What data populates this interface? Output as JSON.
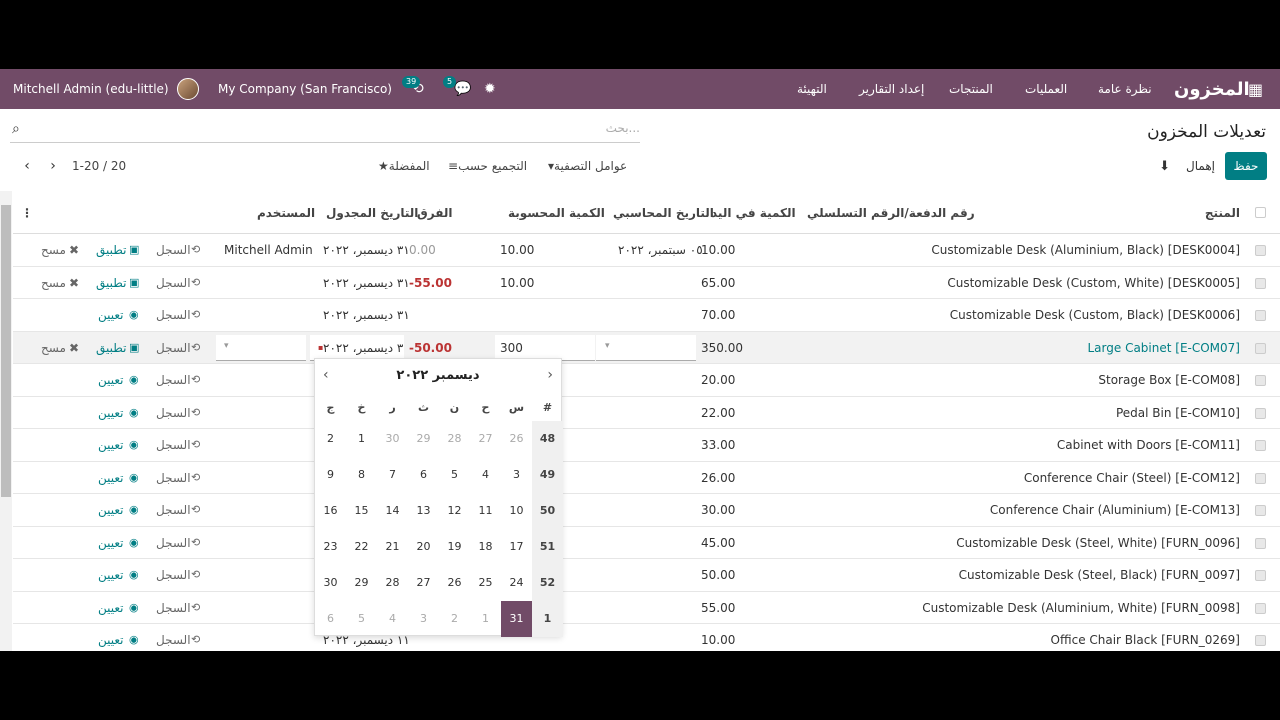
{
  "navbar": {
    "user": "Mitchell Admin (edu-little)",
    "company": "My Company (San Francisco)",
    "activity_count": "39",
    "message_count": "5",
    "brand": "المخزون",
    "menu": [
      "نظرة عامة",
      "العمليات",
      "المنتجات",
      "إعداد التقارير",
      "التهيئة"
    ]
  },
  "control": {
    "title": "تعديلات المخزون",
    "search_placeholder": "بحث...",
    "save": "حفظ",
    "discard": "إهمال",
    "filters": "عوامل التصفية",
    "group_by": "التجميع حسب",
    "favorites": "المفضلة",
    "pager": "1-20 / 20"
  },
  "columns": {
    "product": "المنتج",
    "lot": "رقم الدفعة/الرقم التسلسلي",
    "on_hand": "الكمية في اليد",
    "accounting_date": "التاريخ المحاسبي",
    "counted": "الكمية المحسوبة",
    "difference": "الفرق",
    "scheduled": "التاريخ المجدول",
    "user": "المستخدم"
  },
  "actions": {
    "history": "السجل",
    "apply": "تطبيق",
    "clear": "مسح",
    "set": "تعيين"
  },
  "rows": [
    {
      "product": "Customizable Desk (Aluminium, Black) [DESK0004]",
      "on_hand": "10.00",
      "accounting_date": "٠٥ سبتمبر، ٢٠٢٢",
      "counted": "10.00",
      "difference": "0.00",
      "scheduled": "٣١ ديسمبر، ٢٠٢٢",
      "user": "Mitchell Admin",
      "mode": "apply"
    },
    {
      "product": "Customizable Desk (Custom, White) [DESK0005]",
      "on_hand": "65.00",
      "accounting_date": "",
      "counted": "10.00",
      "difference": "-55.00",
      "scheduled": "٣١ ديسمبر، ٢٠٢٢",
      "user": "",
      "mode": "apply"
    },
    {
      "product": "Customizable Desk (Custom, Black) [DESK0006]",
      "on_hand": "70.00",
      "accounting_date": "",
      "counted": "",
      "difference": "",
      "scheduled": "٣١ ديسمبر، ٢٠٢٢",
      "user": "",
      "mode": "set"
    },
    {
      "product": "Large Cabinet [E-COM07]",
      "on_hand": "350.00",
      "accounting_date": "",
      "counted": "300",
      "difference": "-50.00",
      "scheduled": "٣ ديسمبر، ٢٠٢٢",
      "user": "",
      "mode": "apply"
    },
    {
      "product": "Storage Box [E-COM08]",
      "on_hand": "20.00",
      "mode": "set"
    },
    {
      "product": "Pedal Bin [E-COM10]",
      "on_hand": "22.00",
      "mode": "set"
    },
    {
      "product": "Cabinet with Doors [E-COM11]",
      "on_hand": "33.00",
      "mode": "set"
    },
    {
      "product": "Conference Chair (Steel) [E-COM12]",
      "on_hand": "26.00",
      "mode": "set"
    },
    {
      "product": "Conference Chair (Aluminium) [E-COM13]",
      "on_hand": "30.00",
      "mode": "set"
    },
    {
      "product": "Customizable Desk (Steel, White) [FURN_0096]",
      "on_hand": "45.00",
      "mode": "set"
    },
    {
      "product": "Customizable Desk (Steel, Black) [FURN_0097]",
      "on_hand": "50.00",
      "mode": "set"
    },
    {
      "product": "Customizable Desk (Aluminium, White) [FURN_0098]",
      "on_hand": "55.00",
      "mode": "set"
    },
    {
      "product": "Office Chair Black [FURN_0269]",
      "on_hand": "10.00",
      "scheduled": "١١ ديسمبر، ٢٠٢٢",
      "mode": "set"
    }
  ],
  "datepicker": {
    "title": "ديسمبر ٢٠٢٢",
    "weekdays": [
      "#",
      "س",
      "ح",
      "ن",
      "ث",
      "ر",
      "خ",
      "ج"
    ],
    "weeks": [
      {
        "wk": "48",
        "days": [
          "26",
          "27",
          "28",
          "29",
          "30",
          "1",
          "2"
        ],
        "muted": [
          0,
          1,
          2,
          3,
          4
        ]
      },
      {
        "wk": "49",
        "days": [
          "3",
          "4",
          "5",
          "6",
          "7",
          "8",
          "9"
        ],
        "muted": []
      },
      {
        "wk": "50",
        "days": [
          "10",
          "11",
          "12",
          "13",
          "14",
          "15",
          "16"
        ],
        "muted": []
      },
      {
        "wk": "51",
        "days": [
          "17",
          "18",
          "19",
          "20",
          "21",
          "22",
          "23"
        ],
        "muted": []
      },
      {
        "wk": "52",
        "days": [
          "24",
          "25",
          "26",
          "27",
          "28",
          "29",
          "30"
        ],
        "muted": []
      },
      {
        "wk": "1",
        "days": [
          "31",
          "1",
          "2",
          "3",
          "4",
          "5",
          "6"
        ],
        "muted": [
          1,
          2,
          3,
          4,
          5,
          6
        ]
      }
    ],
    "selected": "31"
  }
}
